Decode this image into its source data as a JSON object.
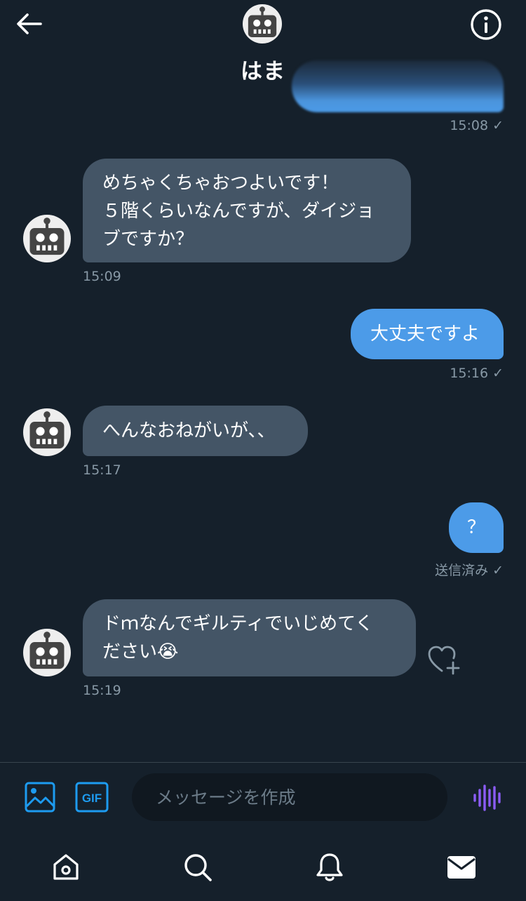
{
  "header": {
    "title": "はま",
    "back_icon": "arrow-left-icon",
    "info_icon": "info-circle-icon"
  },
  "messages": [
    {
      "direction": "out",
      "text": "",
      "time": "15:08",
      "status": "read-check"
    },
    {
      "direction": "in",
      "text": "めちゃくちゃおつよいです！\n５階くらいなんですが、ダイジョ\nブですか？",
      "time": "15:09"
    },
    {
      "direction": "out",
      "text": "大丈夫ですよ",
      "time": "15:16",
      "status": "read-check"
    },
    {
      "direction": "in",
      "text": "へんなおねがいが、、",
      "time": "15:17"
    },
    {
      "direction": "out",
      "text": "？",
      "time": "送信済み",
      "status": "read-check"
    },
    {
      "direction": "in",
      "text": "ドｍなんでギルティでいじめてく\nださい😭",
      "time": "15:19"
    }
  ],
  "composer": {
    "placeholder": "メッセージを作成",
    "image_icon": "image-icon",
    "gif_label": "GIF",
    "voice_icon": "voice-waveform-icon"
  },
  "nav": [
    "home-icon",
    "search-icon",
    "bell-icon",
    "mail-icon"
  ],
  "colors": {
    "background": "#15202b",
    "bubble_in": "#445566",
    "bubble_out": "#4c9be8",
    "accent": "#1d9bf0",
    "voice": "#8b5cf6",
    "meta_text": "#8899a6"
  }
}
